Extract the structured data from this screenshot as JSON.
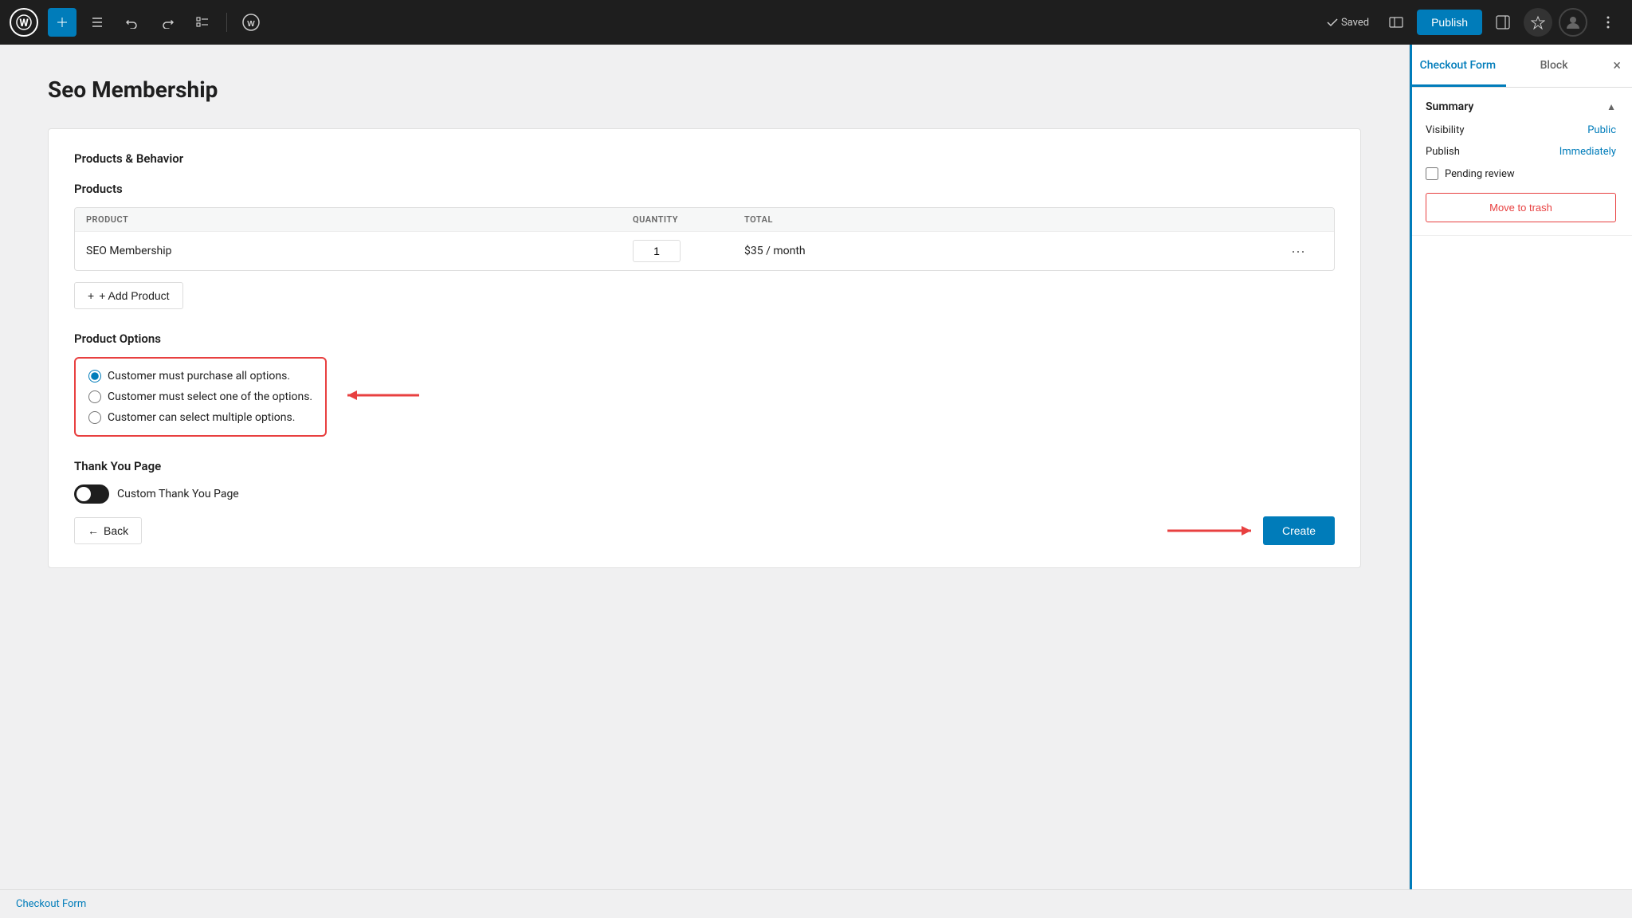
{
  "toolbar": {
    "logo_letter": "W",
    "saved_label": "Saved",
    "publish_label": "Publish"
  },
  "page": {
    "title": "Seo Membership"
  },
  "products_behavior": {
    "section_title": "Products & Behavior",
    "products_title": "Products",
    "table": {
      "headers": [
        "PRODUCT",
        "QUANTITY",
        "TOTAL",
        ""
      ],
      "rows": [
        {
          "product": "SEO Membership",
          "quantity": "1",
          "total": "$35 / month"
        }
      ]
    },
    "add_product_label": "+ Add Product",
    "product_options_title": "Product Options",
    "options": [
      {
        "label": "Customer must purchase all options.",
        "selected": true
      },
      {
        "label": "Customer must select one of the options.",
        "selected": false
      },
      {
        "label": "Customer can select multiple options.",
        "selected": false
      }
    ],
    "thankyou_title": "Thank You Page",
    "thankyou_toggle_label": "Custom Thank You Page"
  },
  "navigation": {
    "back_label": "← Back",
    "create_label": "Create"
  },
  "sidebar": {
    "tabs": [
      {
        "label": "Checkout Form",
        "active": true
      },
      {
        "label": "Block",
        "active": false
      }
    ],
    "close_label": "×",
    "summary": {
      "title": "Summary",
      "visibility_label": "Visibility",
      "visibility_value": "Public",
      "publish_label": "Publish",
      "publish_value": "Immediately",
      "pending_review_label": "Pending review",
      "move_to_trash_label": "Move to trash"
    }
  },
  "breadcrumb": {
    "label": "Checkout Form"
  }
}
